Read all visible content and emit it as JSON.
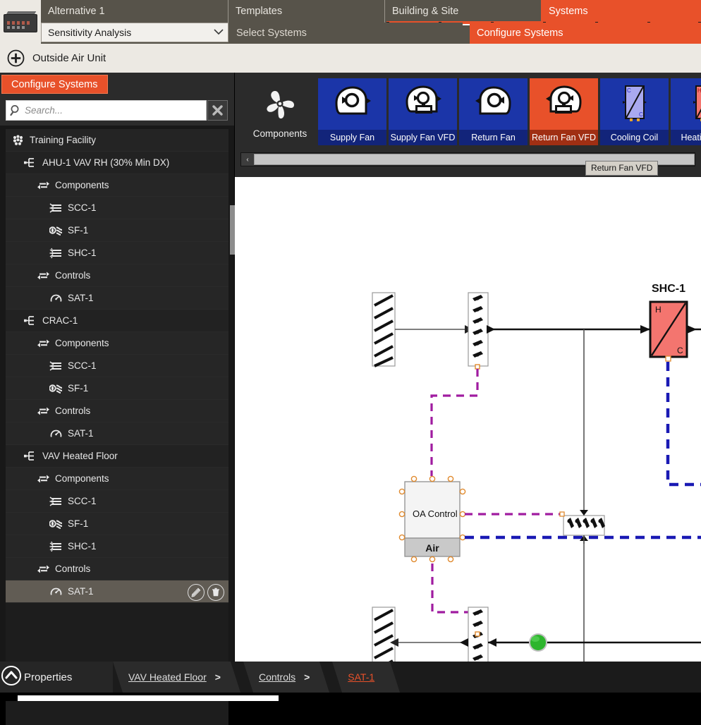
{
  "header": {
    "alternative_tab": "Alternative 1",
    "selector_value": "Sensitivity Analysis",
    "tabs": [
      {
        "label": "Templates",
        "active": false
      },
      {
        "label": "Building & Site",
        "active": false
      },
      {
        "label": "Systems",
        "active": true
      }
    ],
    "subtabs": [
      {
        "label": "Select Systems",
        "active": false
      },
      {
        "label": "Configure Systems",
        "active": true
      }
    ],
    "accent_color": "#e8512a",
    "bar_color": "#57534a"
  },
  "unit_bar": {
    "icon": "plus-circle-icon",
    "title": "Outside Air Unit"
  },
  "left_panel": {
    "tab_label": "Configure Systems",
    "search": {
      "placeholder": "Search...",
      "value": "",
      "icon": "search-icon",
      "clear_icon": "close-x-icon"
    },
    "tree": [
      {
        "label": "Training Facility",
        "depth": 0,
        "icon": "facility-icon",
        "selected": false
      },
      {
        "label": "AHU-1 VAV RH (30% Min DX)",
        "depth": 1,
        "icon": "system-node-icon",
        "selected": false
      },
      {
        "label": "Components",
        "depth": 2,
        "icon": "components-folder-icon",
        "selected": false
      },
      {
        "label": "SCC-1",
        "depth": 3,
        "icon": "cooling-coil-icon",
        "selected": false
      },
      {
        "label": "SF-1",
        "depth": 3,
        "icon": "fan-icon",
        "selected": false
      },
      {
        "label": "SHC-1",
        "depth": 3,
        "icon": "heating-coil-icon",
        "selected": false
      },
      {
        "label": "Controls",
        "depth": 2,
        "icon": "controls-folder-icon",
        "selected": false
      },
      {
        "label": "SAT-1",
        "depth": 3,
        "icon": "sensor-gauge-icon",
        "selected": false
      },
      {
        "label": "CRAC-1",
        "depth": 1,
        "icon": "system-node-icon",
        "selected": false
      },
      {
        "label": "Components",
        "depth": 2,
        "icon": "components-folder-icon",
        "selected": false
      },
      {
        "label": "SCC-1",
        "depth": 3,
        "icon": "cooling-coil-icon",
        "selected": false
      },
      {
        "label": "SF-1",
        "depth": 3,
        "icon": "fan-icon",
        "selected": false
      },
      {
        "label": "Controls",
        "depth": 2,
        "icon": "controls-folder-icon",
        "selected": false
      },
      {
        "label": "SAT-1",
        "depth": 3,
        "icon": "sensor-gauge-icon",
        "selected": false
      },
      {
        "label": "VAV Heated Floor",
        "depth": 1,
        "icon": "system-node-icon",
        "selected": false
      },
      {
        "label": "Components",
        "depth": 2,
        "icon": "components-folder-icon",
        "selected": false
      },
      {
        "label": "SCC-1",
        "depth": 3,
        "icon": "cooling-coil-icon",
        "selected": false
      },
      {
        "label": "SF-1",
        "depth": 3,
        "icon": "fan-icon",
        "selected": false
      },
      {
        "label": "SHC-1",
        "depth": 3,
        "icon": "heating-coil-icon",
        "selected": false
      },
      {
        "label": "Controls",
        "depth": 2,
        "icon": "controls-folder-icon",
        "selected": false
      },
      {
        "label": "SAT-1",
        "depth": 3,
        "icon": "sensor-gauge-icon",
        "selected": true,
        "actions": [
          {
            "name": "edit-icon"
          },
          {
            "name": "delete-icon"
          }
        ]
      }
    ]
  },
  "palette": {
    "group_label": "Components",
    "group_icon": "fan-blade-icon",
    "items": [
      {
        "label": "Supply Fan",
        "icon": "supply-fan-icon",
        "selected": false
      },
      {
        "label": "Supply Fan VFD",
        "icon": "supply-fan-vfd-icon",
        "selected": false
      },
      {
        "label": "Return Fan",
        "icon": "return-fan-icon",
        "selected": false
      },
      {
        "label": "Return Fan VFD",
        "icon": "return-fan-vfd-icon",
        "selected": true
      },
      {
        "label": "Cooling Coil",
        "icon": "cooling-coil-icon",
        "selected": false
      },
      {
        "label": "Heating Coil",
        "icon": "heating-coil-icon",
        "selected": false
      }
    ],
    "tooltip": "Return Fan VFD",
    "scroll_left_arrow": "‹",
    "item_color": "#1b35a8",
    "selected_color": "#e8512a"
  },
  "diagram": {
    "labels": [
      {
        "text": "SHC-1",
        "kind": "component-label"
      },
      {
        "text": "OA Control",
        "kind": "block-title"
      },
      {
        "text": "Air",
        "kind": "block-footer"
      },
      {
        "text": "H",
        "kind": "coil-port"
      },
      {
        "text": "C",
        "kind": "coil-port"
      }
    ],
    "colors": {
      "control_line": "#a01ca0",
      "air_line": "#1a1ab4",
      "duct_line": "#222222",
      "coil_fill": "#f4756f",
      "node_green": "#2db52d",
      "port": "#e08a2e"
    }
  },
  "footer": {
    "properties_label": "Properties",
    "properties_icon": "chevron-up-circle-icon",
    "breadcrumbs": [
      {
        "label": "VAV Heated Floor",
        "separator": ">",
        "current": false
      },
      {
        "label": "Controls",
        "separator": ">",
        "current": false
      },
      {
        "label": "SAT-1",
        "separator": "",
        "current": true
      }
    ]
  }
}
